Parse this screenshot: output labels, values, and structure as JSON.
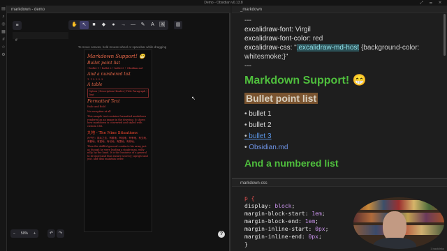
{
  "window": {
    "title": "Demo - Obsidian v0.13.8",
    "controls": "⤢ ▭ ✕"
  },
  "ribbon": {
    "icons": [
      "files-icon",
      "search-icon",
      "graph-icon",
      "calendar-icon",
      "tag-icon",
      "star-icon",
      "settings-icon"
    ],
    "glyphs": [
      "▤",
      "⌕",
      "◎",
      "▦",
      "#",
      "☆",
      "⚙"
    ]
  },
  "left_tab": {
    "title": "markdown - demo"
  },
  "right_tab": {
    "title": "_markdown"
  },
  "css_tab": {
    "title": "markdown-css"
  },
  "excalidraw": {
    "menu_glyph": "≡",
    "tools": [
      "✋",
      "↖",
      "■",
      "◆",
      "●",
      "→",
      "—",
      "✎",
      "A",
      "🖼"
    ],
    "library_glyph": "▥",
    "hint": "To move canvas, hold mouse wheel or spacebar while dragging",
    "mini_panel_text": "#",
    "card": {
      "title": "Markdown Support! 😁",
      "bullet_heading": "Bullet point list",
      "bullets": "• bullet 1 • bullet 2 • bullet 3 • Obsidian.md",
      "numbered_heading": "And a numbered list",
      "numbered": "1. 1  2. 2  3. 3",
      "table_heading": "A table",
      "table": "Option | Description  Header | Title  Paragraph | Text",
      "formatted_heading": "Formatted Text",
      "formatted": "Italic and Bold",
      "quote": "No exception at all",
      "lorem": "This sample text contains formatted markdown rendered as an image in the drawing. It shows how markdown is converted and styled with custom CSS.",
      "nine_heading": "九地 - The Nine Situations",
      "nine_text": "孙子曰：用兵之法，有散地，有轻地，有争地，有交地，有衢地，有重地，有圮地，有围地，有死地。",
      "tail_text": "Then the skillful general conducts his army just as though he were leading a single man, willy-nilly, by the hand. It is the business of a general to be quiet and thus ensure secrecy; upright and just, and thus maintain order."
    },
    "zoom": {
      "minus": "−",
      "value": "50%",
      "plus": "+"
    },
    "undo": "↶",
    "redo": "↷",
    "help": "?",
    "cursor": "↖"
  },
  "markdown": {
    "fence1": "---",
    "font_key": "excalidraw-font:",
    "font_val": " Virgil",
    "color_key": "excalidraw-font-color:",
    "color_val": " red",
    "css_key": "excalidraw-css:",
    "css_q1": " \"",
    "css_class": ".excalidraw-md-host",
    "css_rest": " {background-color: whitesmoke;}\"",
    "fence2": "---",
    "h1": "Markdown Support! 😁",
    "h2": "Bullet point list",
    "bullets": [
      "bullet 1",
      "bullet 2"
    ],
    "link": "bullet 3",
    "obsidian": "Obsidian.md",
    "h3": "And a numbered list"
  },
  "css": {
    "selector": "p {",
    "lines": [
      [
        "  display: ",
        "block",
        ";"
      ],
      [
        "  margin-block-start: ",
        "1em",
        ";"
      ],
      [
        "  margin-block-end: ",
        "1em",
        ";"
      ],
      [
        "  margin-inline-start: ",
        "0px",
        ";"
      ],
      [
        "  margin-inline-end: ",
        "0px",
        ";"
      ]
    ],
    "close": "}"
  },
  "status": "1 backlinks"
}
